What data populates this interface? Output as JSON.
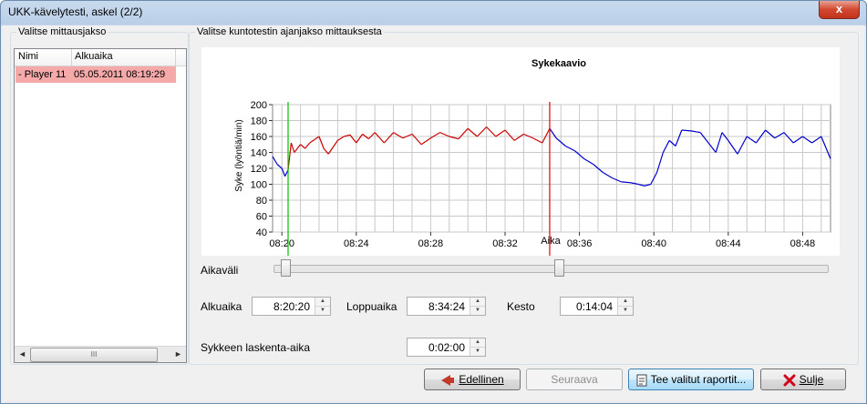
{
  "window": {
    "title": "UKK-kävelytesti, askel (2/2)",
    "close_glyph": "x"
  },
  "left_group": {
    "legend": "Valitse mittausjakso",
    "columns": [
      "Nimi",
      "Alkuaika"
    ],
    "rows": [
      {
        "name": "- Player 11",
        "start": "05.05.2011 08:19:29"
      }
    ],
    "scroll_left": "◄",
    "scroll_right": "►",
    "scroll_grip": "III"
  },
  "right_group": {
    "legend": "Valitse kuntotestin ajanjakso mittauksesta"
  },
  "chart_data": {
    "type": "line",
    "title": "Sykekaavio",
    "xlabel": "Aika",
    "ylabel": "Syke (lyöntiä/min)",
    "ylim": [
      40,
      200
    ],
    "yticks": [
      40,
      60,
      80,
      100,
      120,
      140,
      160,
      180,
      200
    ],
    "xlim": [
      "08:19:30",
      "08:49:30"
    ],
    "xticks": [
      "08:20",
      "08:24",
      "08:28",
      "08:32",
      "08:36",
      "08:40",
      "08:44",
      "08:48"
    ],
    "grid": true,
    "markers": [
      {
        "name": "start",
        "time": "08:20:20",
        "color": "#00c000"
      },
      {
        "name": "end",
        "time": "08:34:24",
        "color": "#e00000"
      }
    ],
    "colors": {
      "outside": "#0000cc",
      "inside": "#cc0000"
    },
    "series": [
      {
        "x": [
          "08:19:30",
          "08:19:45",
          "08:20:00",
          "08:20:10",
          "08:20:20",
          "08:20:30",
          "08:20:40",
          "08:21:00",
          "08:21:15",
          "08:21:30",
          "08:22:00",
          "08:22:15",
          "08:22:30",
          "08:23:00",
          "08:23:20",
          "08:23:40",
          "08:24:00",
          "08:24:20",
          "08:24:40",
          "08:25:00",
          "08:25:30",
          "08:26:00",
          "08:26:30",
          "08:27:00",
          "08:27:30",
          "08:28:00",
          "08:28:30",
          "08:29:00",
          "08:29:30",
          "08:30:00",
          "08:30:30",
          "08:31:00",
          "08:31:30",
          "08:32:00",
          "08:32:30",
          "08:33:00",
          "08:33:30",
          "08:34:00",
          "08:34:24",
          "08:34:45",
          "08:35:15",
          "08:35:45",
          "08:36:15",
          "08:36:45",
          "08:37:15",
          "08:37:45",
          "08:38:15",
          "08:38:45",
          "08:39:10",
          "08:39:30",
          "08:39:50",
          "08:40:10",
          "08:40:30",
          "08:40:50",
          "08:41:10",
          "08:41:30",
          "08:42:00",
          "08:42:30",
          "08:43:00",
          "08:43:20",
          "08:43:40",
          "08:44:00",
          "08:44:30",
          "08:45:00",
          "08:45:30",
          "08:46:00",
          "08:46:30",
          "08:47:00",
          "08:47:30",
          "08:48:00",
          "08:48:30",
          "08:49:00",
          "08:49:30"
        ],
        "y": [
          135,
          125,
          120,
          110,
          118,
          152,
          140,
          150,
          145,
          152,
          160,
          145,
          138,
          155,
          160,
          162,
          152,
          163,
          157,
          165,
          152,
          165,
          158,
          163,
          150,
          158,
          165,
          160,
          157,
          170,
          160,
          172,
          160,
          168,
          155,
          163,
          158,
          152,
          170,
          158,
          148,
          142,
          132,
          125,
          115,
          108,
          103,
          102,
          100,
          98,
          100,
          115,
          140,
          155,
          148,
          168,
          167,
          165,
          150,
          140,
          165,
          155,
          138,
          160,
          152,
          168,
          158,
          165,
          152,
          160,
          152,
          160,
          132
        ]
      }
    ]
  },
  "controls": {
    "aikavali_label": "Aikaväli",
    "alkuaika_label": "Alkuaika",
    "alkuaika_value": "8:20:20",
    "loppuaika_label": "Loppuaika",
    "loppuaika_value": "8:34:24",
    "kesto_label": "Kesto",
    "kesto_value": "0:14:04",
    "sykkeen_label": "Sykkeen laskenta-aika",
    "sykkeen_value": "0:02:00",
    "spin_up": "▲",
    "spin_down": "▼"
  },
  "buttons": {
    "prev": "Edellinen",
    "next": "Seuraava",
    "report": "Tee valitut raportit...",
    "close": "Sulje"
  }
}
